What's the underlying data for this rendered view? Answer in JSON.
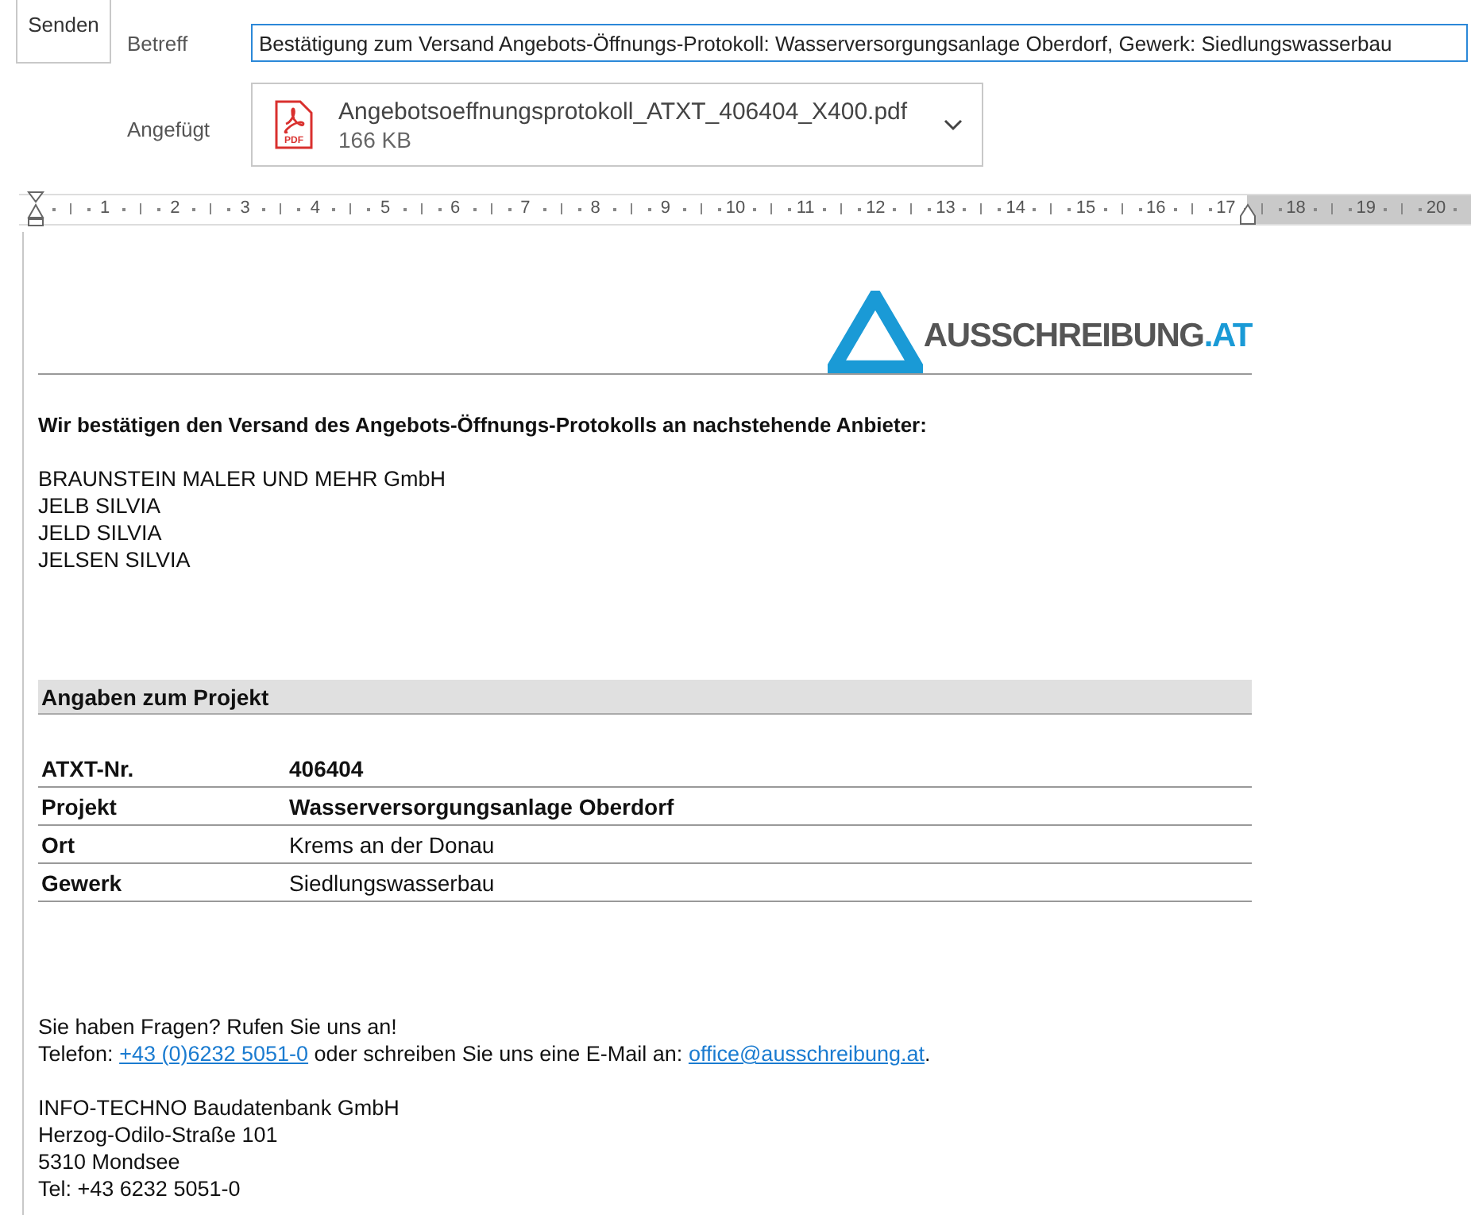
{
  "toolbar": {
    "send_button": "Senden"
  },
  "subject": {
    "label": "Betreff",
    "value": "Bestätigung zum Versand Angebots-Öffnungs-Protokoll: Wasserversorgungsanlage Oberdorf, Gewerk: Siedlungswasserbau"
  },
  "attachment": {
    "label": "Angefügt",
    "file_name": "Angebotsoeffnungsprotokoll_ATXT_406404_X400.pdf",
    "size": "166 KB",
    "file_type": "PDF"
  },
  "ruler": {
    "marks": [
      "1",
      "2",
      "3",
      "4",
      "5",
      "6",
      "7",
      "8",
      "9",
      "10",
      "11",
      "12",
      "13",
      "14",
      "15",
      "16",
      "17",
      "18",
      "19",
      "20"
    ]
  },
  "email_body": {
    "logo": {
      "name": "AUSSCHREIBUNG",
      "suffix": ".AT"
    },
    "intro": "Wir bestätigen den Versand des Angebots-Öffnungs-Protokolls an nachstehende Anbieter:",
    "bidders": [
      "BRAUNSTEIN MALER UND MEHR GmbH",
      "JELB SILVIA",
      "JELD SILVIA",
      "JELSEN SILVIA"
    ],
    "section_title": "Angaben zum Projekt",
    "details": [
      {
        "label": "ATXT-Nr.",
        "value": "406404",
        "bold": true
      },
      {
        "label": "Projekt",
        "value": "Wasserversorgungsanlage Oberdorf",
        "bold": true
      },
      {
        "label": "Ort",
        "value": "Krems an der Donau",
        "bold": false
      },
      {
        "label": "Gewerk",
        "value": "Siedlungswasserbau",
        "bold": false
      }
    ],
    "contact": {
      "question": "Sie haben Fragen? Rufen Sie uns an!",
      "phone_label": "Telefon:",
      "phone_link": "+43 (0)6232 5051-0",
      "middle": "oder schreiben Sie uns eine E-Mail an:",
      "email_link": "office@ausschreibung.at",
      "end": "."
    },
    "address_lines": [
      "INFO-TECHNO Baudatenbank GmbH",
      "Herzog-Odilo-Straße 101",
      "5310 Mondsee",
      "Tel: +43 6232 5051-0"
    ]
  }
}
